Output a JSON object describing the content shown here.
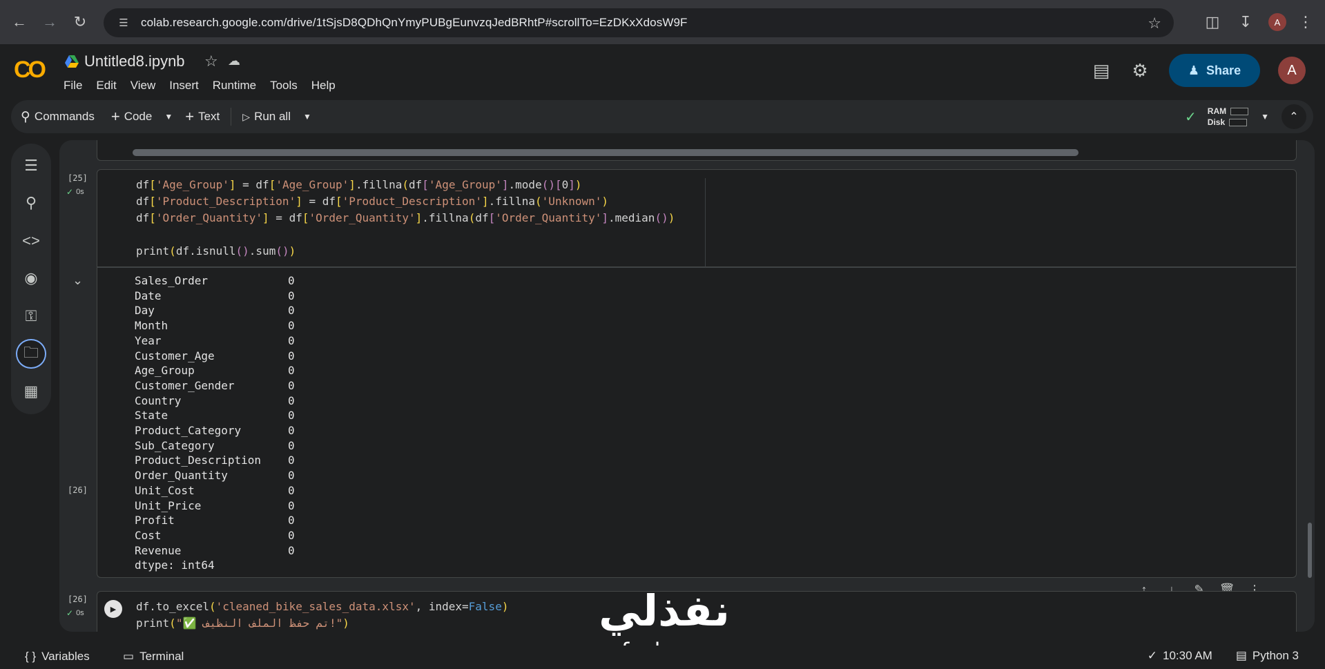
{
  "browser": {
    "url": "colab.research.google.com/drive/1tSjsD8QDhQnYmyPUBgEunvzqJedBRhtP#scrollTo=EzDKxXdosW9F",
    "profile_initial": "A"
  },
  "header": {
    "logo_text": "CO",
    "notebook_title": "Untitled8.ipynb",
    "menu": [
      "File",
      "Edit",
      "View",
      "Insert",
      "Runtime",
      "Tools",
      "Help"
    ],
    "share_label": "Share",
    "user_initial": "A"
  },
  "toolbar": {
    "commands_label": "Commands",
    "code_label": "Code",
    "text_label": "Text",
    "run_all_label": "Run all",
    "ram_label": "RAM",
    "disk_label": "Disk"
  },
  "cells": [
    {
      "execution_count": "[25]",
      "duration": "0s",
      "code": [
        "df['Age_Group'] = df['Age_Group'].fillna(df['Age_Group'].mode()[0])",
        "df['Product_Description'] = df['Product_Description'].fillna('Unknown')",
        "df['Order_Quantity'] = df['Order_Quantity'].fillna(df['Order_Quantity'].median())",
        "",
        "print(df.isnull().sum())"
      ],
      "output": {
        "rows": [
          {
            "name": "Sales_Order",
            "value": "0"
          },
          {
            "name": "Date",
            "value": "0"
          },
          {
            "name": "Day",
            "value": "0"
          },
          {
            "name": "Month",
            "value": "0"
          },
          {
            "name": "Year",
            "value": "0"
          },
          {
            "name": "Customer_Age",
            "value": "0"
          },
          {
            "name": "Age_Group",
            "value": "0"
          },
          {
            "name": "Customer_Gender",
            "value": "0"
          },
          {
            "name": "Country",
            "value": "0"
          },
          {
            "name": "State",
            "value": "0"
          },
          {
            "name": "Product_Category",
            "value": "0"
          },
          {
            "name": "Sub_Category",
            "value": "0"
          },
          {
            "name": "Product_Description",
            "value": "0"
          },
          {
            "name": "Order_Quantity",
            "value": "0"
          },
          {
            "name": "Unit_Cost",
            "value": "0"
          },
          {
            "name": "Unit_Price",
            "value": "0"
          },
          {
            "name": "Profit",
            "value": "0"
          },
          {
            "name": "Cost",
            "value": "0"
          },
          {
            "name": "Revenue",
            "value": "0"
          }
        ],
        "dtype": "dtype: int64"
      }
    },
    {
      "execution_count": "[26]",
      "duration": "0s",
      "code": [
        "df.to_excel('cleaned_bike_sales_data.xlsx', index=False)",
        "print(\"✅ تم حفظ الملف النظيف!\")"
      ]
    }
  ],
  "watermark": {
    "arabic": "نفذلي",
    "latin": "nafezly.com"
  },
  "statusbar": {
    "variables_label": "Variables",
    "terminal_label": "Terminal",
    "time": "10:30 AM",
    "kernel": "Python 3"
  },
  "colors": {
    "accent": "#004a77",
    "logo": "#f9ab00",
    "success": "#6dd58c",
    "string": "#ce9178",
    "keyword": "#569cd6"
  }
}
